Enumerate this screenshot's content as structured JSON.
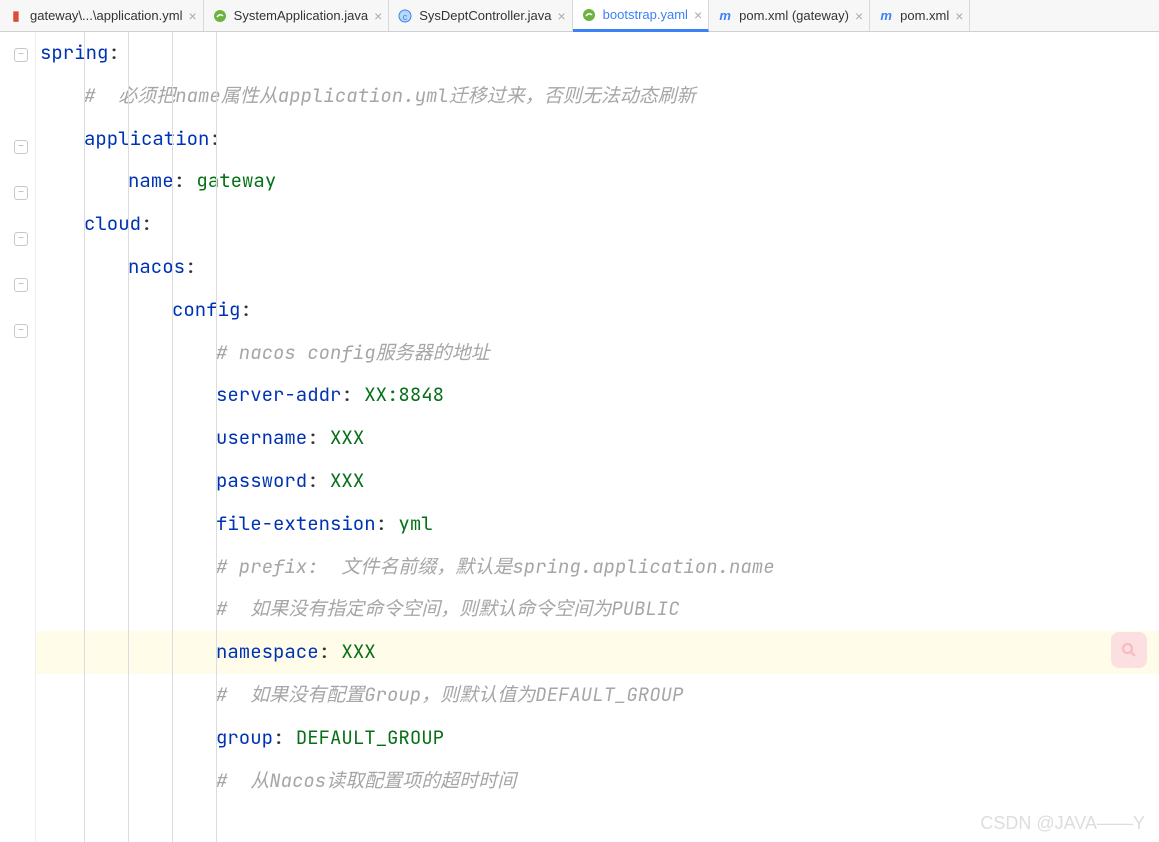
{
  "tabs": [
    {
      "label": "gateway\\...\\application.yml",
      "icon": "yaml-icon",
      "active": false
    },
    {
      "label": "SystemApplication.java",
      "icon": "spring-icon",
      "active": false
    },
    {
      "label": "SysDeptController.java",
      "icon": "java-icon",
      "active": false
    },
    {
      "label": "bootstrap.yaml",
      "icon": "spring-icon",
      "active": true
    },
    {
      "label": "pom.xml (gateway)",
      "icon": "m-icon",
      "active": false
    },
    {
      "label": "pom.xml",
      "icon": "m-icon",
      "active": false
    }
  ],
  "code": {
    "lines": [
      {
        "indent": 0,
        "type": "key",
        "key": "spring",
        "value": ""
      },
      {
        "indent": 1,
        "type": "comment",
        "text": "#  必须把name属性从application.yml迁移过来，否则无法动态刷新"
      },
      {
        "indent": 1,
        "type": "key",
        "key": "application",
        "value": ""
      },
      {
        "indent": 2,
        "type": "kv",
        "key": "name",
        "value": "gateway"
      },
      {
        "indent": 1,
        "type": "key",
        "key": "cloud",
        "value": ""
      },
      {
        "indent": 2,
        "type": "key",
        "key": "nacos",
        "value": ""
      },
      {
        "indent": 3,
        "type": "key",
        "key": "config",
        "value": ""
      },
      {
        "indent": 4,
        "type": "comment",
        "text": "# nacos config服务器的地址"
      },
      {
        "indent": 4,
        "type": "kv",
        "key": "server-addr",
        "value": "XX:8848"
      },
      {
        "indent": 4,
        "type": "kv",
        "key": "username",
        "value": "XXX"
      },
      {
        "indent": 4,
        "type": "kv",
        "key": "password",
        "value": "XXX"
      },
      {
        "indent": 4,
        "type": "kv",
        "key": "file-extension",
        "value": "yml"
      },
      {
        "indent": 4,
        "type": "comment",
        "text": "# prefix:  文件名前缀，默认是spring.application.name"
      },
      {
        "indent": 4,
        "type": "comment",
        "text": "#  如果没有指定命令空间，则默认命令空间为PUBLIC"
      },
      {
        "indent": 4,
        "type": "kv",
        "key": "namespace",
        "value": "XXX",
        "highlight": true
      },
      {
        "indent": 4,
        "type": "comment",
        "text": "#  如果没有配置Group，则默认值为DEFAULT_GROUP"
      },
      {
        "indent": 4,
        "type": "kv",
        "key": "group",
        "value": "DEFAULT_GROUP"
      },
      {
        "indent": 4,
        "type": "comment",
        "text": "#  从Nacos读取配置项的超时时间"
      }
    ]
  },
  "watermark": "CSDN @JAVA——Y",
  "fold_positions": [
    16,
    108,
    154,
    200,
    246,
    292
  ]
}
